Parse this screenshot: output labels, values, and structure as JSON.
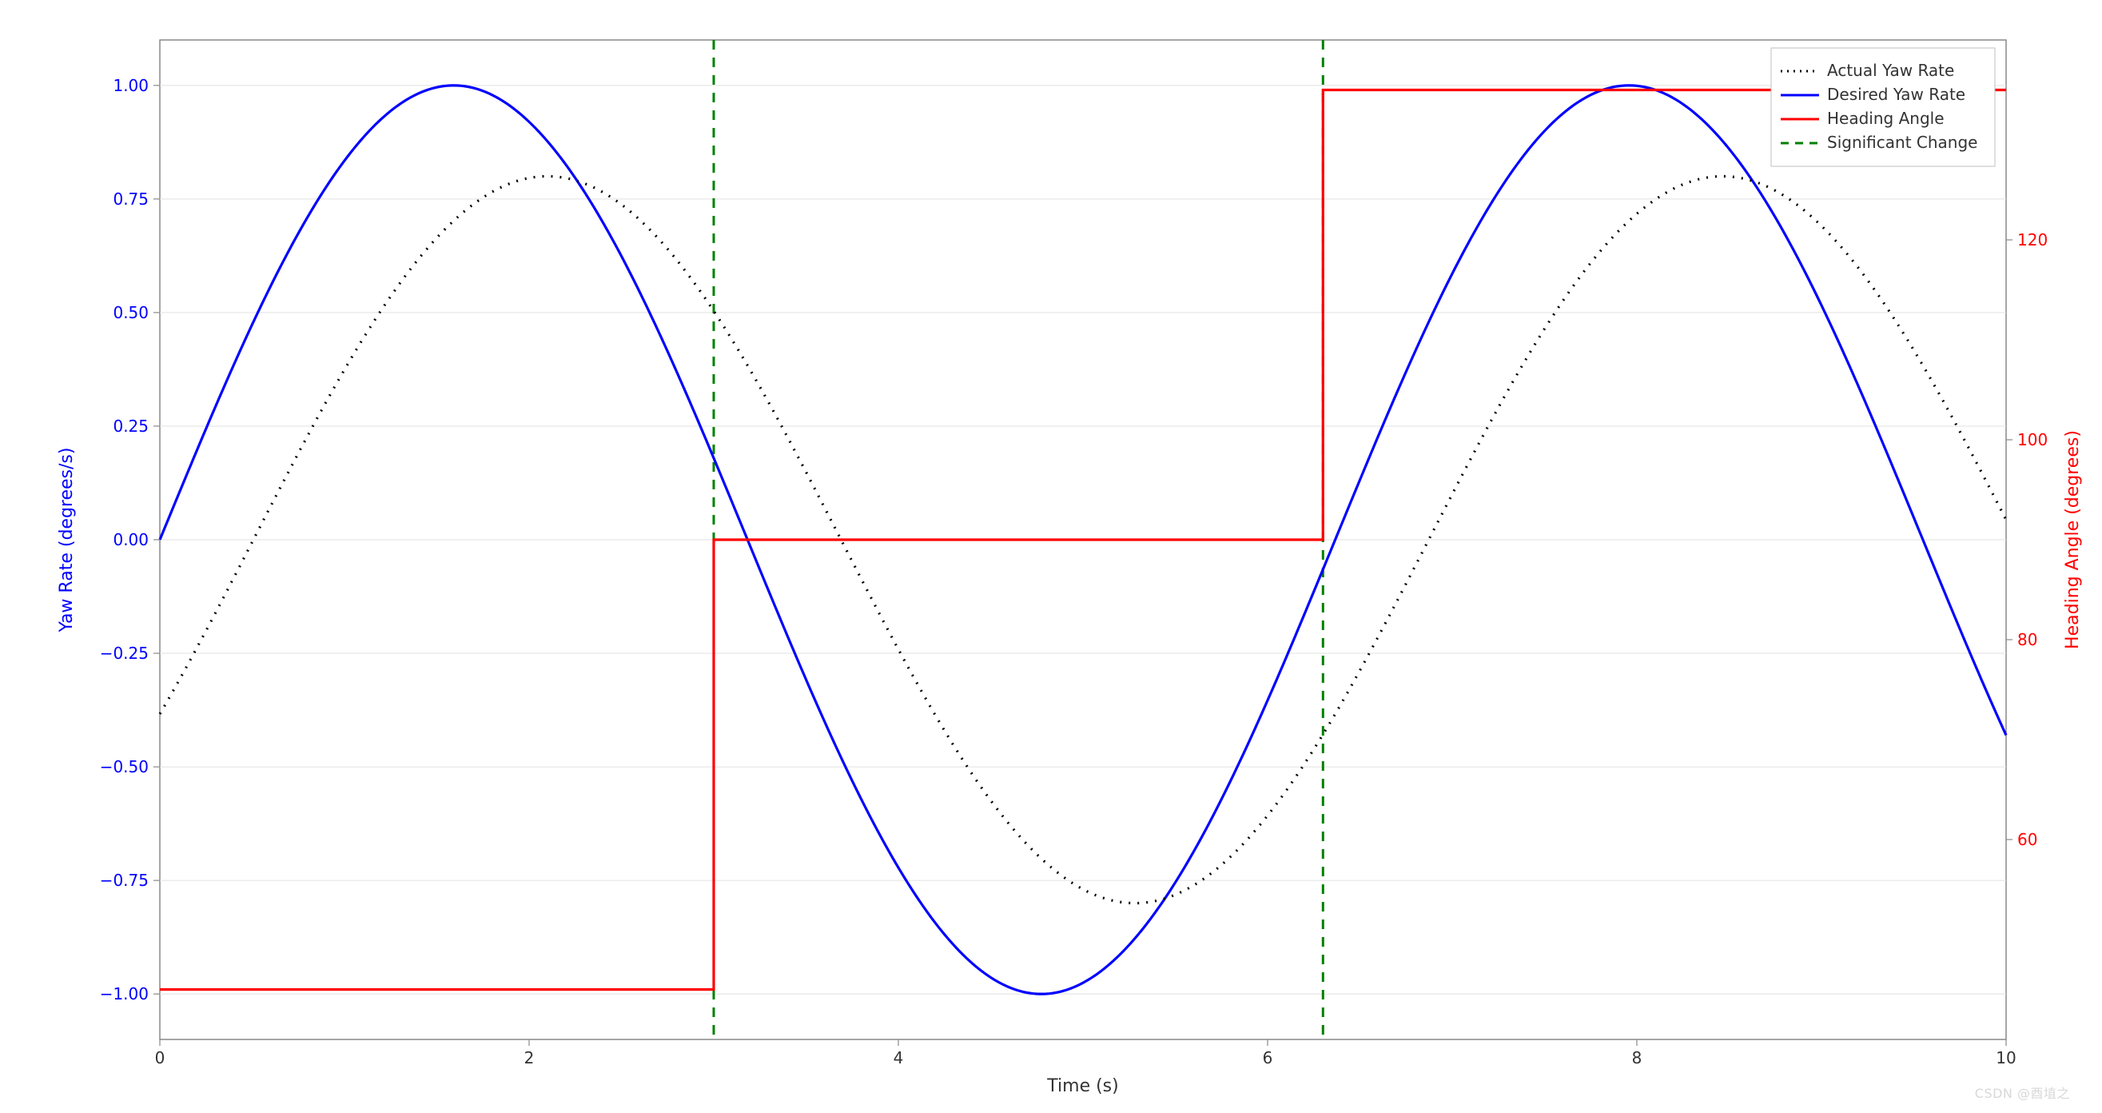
{
  "chart_data": {
    "type": "line",
    "xlabel": "Time (s)",
    "ylabel_left": "Yaw Rate (degrees/s)",
    "ylabel_right": "Heading Angle (degrees)",
    "xlim": [
      0,
      10
    ],
    "ylim_left": [
      -1.1,
      1.1
    ],
    "ylim_right": [
      40,
      140
    ],
    "x_ticks": [
      0,
      2,
      4,
      6,
      8,
      10
    ],
    "y_ticks_left": [
      -1.0,
      -0.75,
      -0.5,
      -0.25,
      0.0,
      0.25,
      0.5,
      0.75,
      1.0
    ],
    "y_ticks_right": [
      60,
      80,
      100,
      120
    ],
    "significant_changes_x": [
      3.0,
      6.3
    ],
    "series": [
      {
        "name": "Desired Yaw Rate",
        "axis": "left",
        "color": "#0000ff",
        "style": "solid",
        "formula": "sin(pi*t/(10/pi))",
        "x": [
          0,
          0.5,
          1.0,
          1.5,
          2.0,
          2.5,
          3.0,
          3.5,
          4.0,
          4.5,
          5.0,
          5.5,
          6.0,
          6.3,
          6.5,
          7.0,
          7.5,
          8.0,
          8.5,
          9.0,
          9.5,
          10.0
        ],
        "y": [
          0.0,
          0.48,
          0.84,
          1.0,
          0.91,
          0.6,
          0.14,
          -0.35,
          -0.76,
          -0.98,
          -0.96,
          -0.71,
          -0.28,
          0.0,
          0.22,
          0.66,
          0.94,
          0.99,
          0.8,
          0.41,
          -0.08,
          -0.54
        ]
      },
      {
        "name": "Actual Yaw Rate",
        "axis": "left",
        "color": "#000000",
        "style": "dotted",
        "formula": "0.8*sin(pi*t/(10/pi) - 0.5)",
        "x": [
          0,
          0.5,
          1.0,
          1.5,
          2.0,
          2.5,
          3.0,
          3.5,
          4.0,
          4.5,
          5.0,
          5.5,
          6.0,
          6.3,
          6.5,
          7.0,
          7.5,
          8.0,
          8.5,
          9.0,
          9.5,
          10.0
        ],
        "y": [
          -0.38,
          0.01,
          0.4,
          0.68,
          0.8,
          0.72,
          0.47,
          0.1,
          -0.3,
          -0.62,
          -0.79,
          -0.77,
          -0.54,
          -0.35,
          -0.17,
          0.24,
          0.58,
          0.78,
          0.79,
          0.6,
          0.25,
          -0.15
        ]
      },
      {
        "name": "Heading Angle",
        "axis": "right",
        "color": "#ff0000",
        "style": "solid",
        "step": true,
        "x": [
          0,
          3.0,
          3.0,
          6.3,
          6.3,
          10.0
        ],
        "y": [
          45,
          45,
          90,
          90,
          135,
          135
        ]
      }
    ],
    "legend": {
      "position": "upper-right",
      "entries": [
        "Actual Yaw Rate",
        "Desired Yaw Rate",
        "Heading Angle",
        "Significant Change"
      ]
    },
    "grid": true
  },
  "labels": {
    "xlabel": "Time (s)",
    "ylabel_left": "Yaw Rate (degrees/s)",
    "ylabel_right": "Heading Angle (degrees)",
    "legend_actual": "Actual Yaw Rate",
    "legend_desired": "Desired Yaw Rate",
    "legend_heading": "Heading Angle",
    "legend_sig": "Significant Change",
    "watermark": "CSDN @酉埴之"
  },
  "ticks": {
    "left": [
      "−1.00",
      "−0.75",
      "−0.50",
      "−0.25",
      "0.00",
      "0.25",
      "0.50",
      "0.75",
      "1.00"
    ],
    "right": [
      "60",
      "80",
      "100",
      "120"
    ],
    "bottom": [
      "0",
      "2",
      "4",
      "6",
      "8",
      "10"
    ]
  },
  "colors": {
    "blue": "#0000ff",
    "black": "#000000",
    "red": "#ff0000",
    "green": "#008000",
    "grid": "#e0e0e0",
    "spine": "#888888",
    "left_text": "#0000ff",
    "right_text": "#ff0000"
  }
}
